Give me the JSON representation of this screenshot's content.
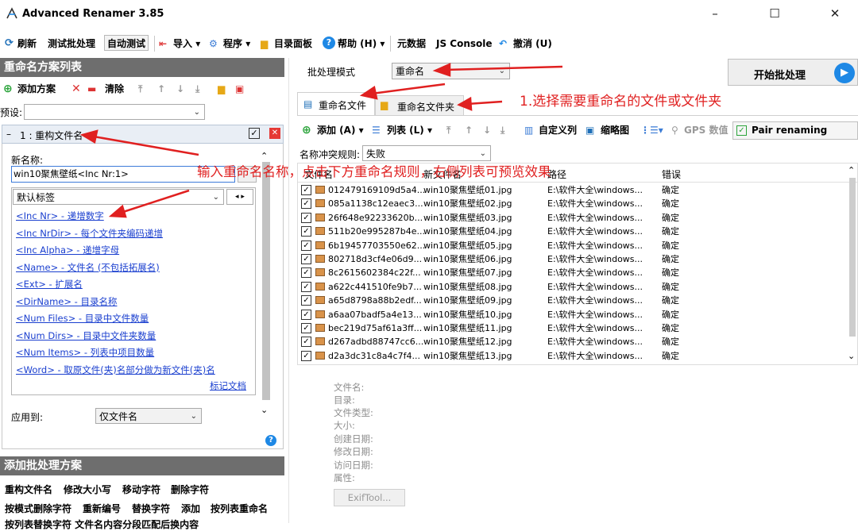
{
  "window": {
    "title": "Advanced Renamer 3.85",
    "min_glyph": "–",
    "max_glyph": "☐",
    "close_glyph": "✕"
  },
  "menu": {
    "refresh": "刷新",
    "test_batch": "测试批处理",
    "auto_test": "自动测试",
    "import": "导入",
    "program": "程序",
    "dir_panel": "目录面板",
    "help": "帮助 (H)",
    "metadata": "元数据",
    "js_console": "JS Console",
    "undo": "撤消 (U)"
  },
  "left_panel": {
    "header": "重命名方案列表",
    "add_method": "添加方案",
    "clear": "清除",
    "preset_label": "预设:",
    "method_title": "1 : 重构文件名",
    "new_name_label": "新名称:",
    "new_name_value": "win10聚焦壁纸<Inc Nr:1>",
    "tags_dropdown": "默认标签",
    "tags": [
      "<Inc Nr> - 递增数字",
      "<Inc NrDir> - 每个文件夹编码递增",
      "<Inc Alpha> - 递增字母",
      "<Name> - 文件名 (不包括拓展名)",
      "<Ext> - 扩展名",
      "<DirName> - 目录名称",
      "<Num Files> - 目录中文件数量",
      "<Num Dirs> - 目录中文件夹数量",
      "<Num Items> - 列表中项目数量",
      "<Word> - 取原文件(夹)名部分做为新文件(夹)名"
    ],
    "tag_docs": "标记文档",
    "apply_to_label": "应用到:",
    "apply_to_value": "仅文件名",
    "help_glyph": "?"
  },
  "batch_panel": {
    "header": "添加批处理方案",
    "items": [
      "重构文件名",
      "修改大小写",
      "移动字符",
      "删除字符",
      "按模式删除字符",
      "重新编号",
      "替换字符",
      "添加",
      "按列表重命名"
    ],
    "cut_off_text": "按列表替换字符    文件名内容分段匹配后换内容"
  },
  "right": {
    "mode_label": "批处理模式",
    "mode_value": "重命名",
    "start_button": "开始批处理",
    "tab_files": "重命名文件",
    "tab_folders": "重命名文件夹",
    "add": "添加 (A)",
    "list": "列表 (L)",
    "custom_columns": "自定义列",
    "thumbnails": "缩略图",
    "gps": "GPS 数值",
    "pair_renaming": "Pair renaming",
    "conflict_label": "名称冲突规则:",
    "conflict_value": "失败",
    "columns": [
      "文件名",
      "新文件名",
      "路径",
      "错误"
    ],
    "rows": [
      [
        "012479169109d5a4...",
        "win10聚焦壁纸01.jpg",
        "E:\\软件大全\\windows...",
        "确定"
      ],
      [
        "085a1138c12eaec3...",
        "win10聚焦壁纸02.jpg",
        "E:\\软件大全\\windows...",
        "确定"
      ],
      [
        "26f648e92233620b...",
        "win10聚焦壁纸03.jpg",
        "E:\\软件大全\\windows...",
        "确定"
      ],
      [
        "511b20e995287b4e...",
        "win10聚焦壁纸04.jpg",
        "E:\\软件大全\\windows...",
        "确定"
      ],
      [
        "6b19457703550e62...",
        "win10聚焦壁纸05.jpg",
        "E:\\软件大全\\windows...",
        "确定"
      ],
      [
        "802718d3cf4e06d9...",
        "win10聚焦壁纸06.jpg",
        "E:\\软件大全\\windows...",
        "确定"
      ],
      [
        "8c2615602384c22f...",
        "win10聚焦壁纸07.jpg",
        "E:\\软件大全\\windows...",
        "确定"
      ],
      [
        "a622c441510fe9b7...",
        "win10聚焦壁纸08.jpg",
        "E:\\软件大全\\windows...",
        "确定"
      ],
      [
        "a65d8798a88b2edf...",
        "win10聚焦壁纸09.jpg",
        "E:\\软件大全\\windows...",
        "确定"
      ],
      [
        "a6aa07badf5a4e13...",
        "win10聚焦壁纸10.jpg",
        "E:\\软件大全\\windows...",
        "确定"
      ],
      [
        "bec219d75af61a3ff...",
        "win10聚焦壁纸11.jpg",
        "E:\\软件大全\\windows...",
        "确定"
      ],
      [
        "d267adbd88747cc6...",
        "win10聚焦壁纸12.jpg",
        "E:\\软件大全\\windows...",
        "确定"
      ],
      [
        "d2a3dc31c8a4c7f4...",
        "win10聚焦壁纸13.jpg",
        "E:\\软件大全\\windows...",
        "确定"
      ]
    ],
    "properties": [
      "文件名:",
      "目录:",
      "文件类型:",
      "大小:",
      "创建日期:",
      "修改日期:",
      "访问日期:",
      "属性:"
    ],
    "exiftool": "ExifTool..."
  },
  "annotations": {
    "select_files": "1.选择需要重命名的文件或文件夹",
    "rename_hint": "输入重命名名称，点击下方重命名规则，右侧列表可预览效果"
  },
  "colors": {
    "annotation": "#e02020",
    "link": "#1a3fcf",
    "panel_header": "#6e6e6e",
    "accent_blue": "#1e88e5"
  }
}
